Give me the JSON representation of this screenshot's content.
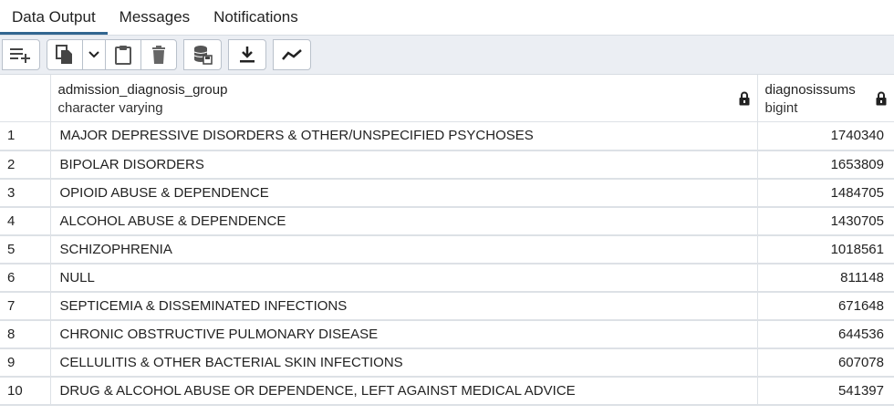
{
  "tabs": [
    {
      "label": "Data Output",
      "active": true
    },
    {
      "label": "Messages",
      "active": false
    },
    {
      "label": "Notifications",
      "active": false
    }
  ],
  "toolbar": {
    "icons": [
      "add-row-icon",
      "copy-icon",
      "chevron-down-icon",
      "paste-icon",
      "delete-icon",
      "save-data-icon",
      "download-icon",
      "graph-icon"
    ]
  },
  "columns": [
    {
      "name": "admission_diagnosis_group",
      "type": "character varying"
    },
    {
      "name": "diagnosissums",
      "type": "bigint"
    }
  ],
  "rows": [
    {
      "n": "1",
      "group": "MAJOR DEPRESSIVE DISORDERS & OTHER/UNSPECIFIED PSYCHOSES",
      "sum": "1740340"
    },
    {
      "n": "2",
      "group": "BIPOLAR DISORDERS",
      "sum": "1653809"
    },
    {
      "n": "3",
      "group": "OPIOID ABUSE & DEPENDENCE",
      "sum": "1484705"
    },
    {
      "n": "4",
      "group": "ALCOHOL ABUSE & DEPENDENCE",
      "sum": "1430705"
    },
    {
      "n": "5",
      "group": "SCHIZOPHRENIA",
      "sum": "1018561"
    },
    {
      "n": "6",
      "group": "NULL",
      "sum": "811148"
    },
    {
      "n": "7",
      "group": "SEPTICEMIA & DISSEMINATED INFECTIONS",
      "sum": "671648"
    },
    {
      "n": "8",
      "group": "CHRONIC OBSTRUCTIVE PULMONARY DISEASE",
      "sum": "644536"
    },
    {
      "n": "9",
      "group": "CELLULITIS & OTHER BACTERIAL SKIN INFECTIONS",
      "sum": "607078"
    },
    {
      "n": "10",
      "group": "DRUG & ALCOHOL ABUSE OR DEPENDENCE, LEFT AGAINST MEDICAL ADVICE",
      "sum": "541397"
    }
  ],
  "colors": {
    "accent": "#326690",
    "toolbar_bg": "#ebeef3",
    "border": "#dde1e6"
  }
}
